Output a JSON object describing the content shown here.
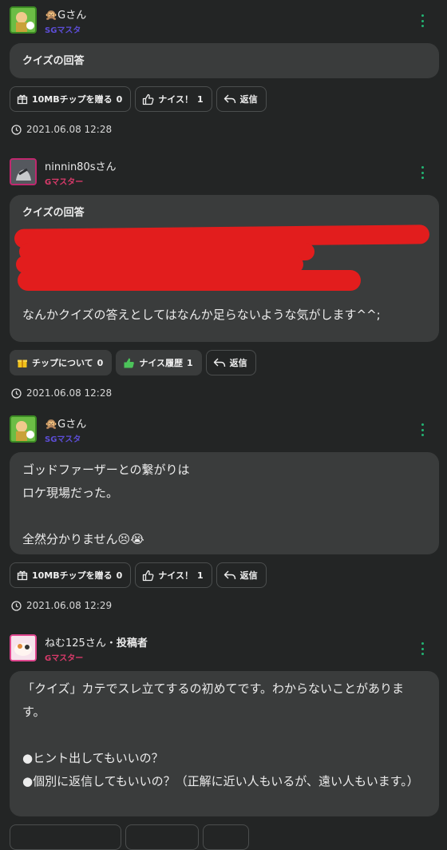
{
  "posts": [
    {
      "username": "🙊Gさん",
      "rank": "SGマスタ",
      "title": "クイズの回答",
      "body": "",
      "actions": {
        "chip": "10MBチップを贈る",
        "chip_count": "0",
        "like": "ナイス！",
        "like_count": "1",
        "reply": "返信"
      },
      "date": "2021.06.08 12:28"
    },
    {
      "username": "ninnin80sさん",
      "rank": "Gマスター",
      "title": "クイズの回答",
      "body": "なんかクイズの答えとしてはなんか足らないような気がします^^;",
      "actions": {
        "chip": "チップについて",
        "chip_count": "0",
        "like": "ナイス履歴",
        "like_count": "1",
        "reply": "返信"
      },
      "date": "2021.06.08 12:28"
    },
    {
      "username": "🙊Gさん",
      "rank": "SGマスタ",
      "title": "",
      "body": "ゴッドファーザーとの繋がりは\nロケ現場だった。\n\n全然分かりません😣😭",
      "actions": {
        "chip": "10MBチップを贈る",
        "chip_count": "0",
        "like": "ナイス！",
        "like_count": "1",
        "reply": "返信"
      },
      "date": "2021.06.08 12:29"
    },
    {
      "username": "ねむ125さん・",
      "role": "投稿者",
      "rank": "Gマスター",
      "title": "",
      "body": "「クイズ」カテでスレ立てするの初めてです。わからないことがあります。\n\n●ヒント出してもいいの？\n●個別に返信してもいいの？（正解に近い人もいるが、遠い人もいます。）"
    }
  ],
  "colors": {
    "background": "#232525",
    "bubble": "#3a3c3c",
    "sg_rank": "#5c4dd6",
    "g_rank": "#d83a6a",
    "menu_dots": "#22b573",
    "redaction": "#e21d1d"
  },
  "icons": [
    "gift-icon",
    "thumbs-up-icon",
    "reply-icon",
    "clock-icon",
    "kebab-menu-icon"
  ]
}
